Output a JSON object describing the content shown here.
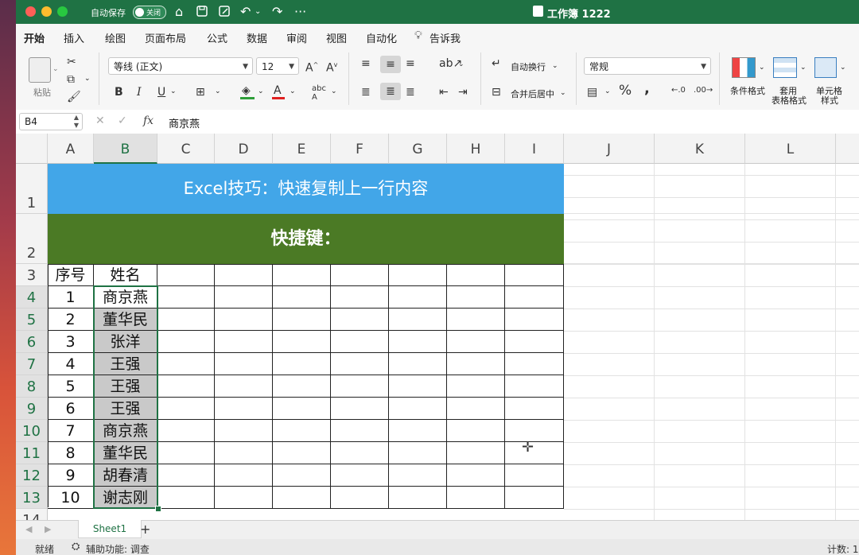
{
  "titlebar": {
    "autosave_label": "自动保存",
    "autosave_state": "关闭",
    "title": "工作簿 1222",
    "icons": [
      "home-icon",
      "save-icon",
      "save-as-icon",
      "undo-icon",
      "redo-icon",
      "more-icon"
    ]
  },
  "menu": [
    "开始",
    "插入",
    "绘图",
    "页面布局",
    "公式",
    "数据",
    "审阅",
    "视图",
    "自动化",
    "告诉我"
  ],
  "ribbon": {
    "paste_label": "粘贴",
    "font_name": "等线 (正文)",
    "font_size": "12",
    "wrap_text": "自动换行",
    "merge_center": "合并后居中",
    "number_format": "常规",
    "conditional_format": "条件格式",
    "table_format_line1": "套用",
    "table_format_line2": "表格格式",
    "cell_style_line1": "单元格",
    "cell_style_line2": "样式",
    "bold": "B",
    "italic": "I",
    "underline": "U",
    "percent": "%",
    "comma": ",",
    "fx": "fx"
  },
  "formula_bar": {
    "name_box": "B4",
    "formula": "商京燕"
  },
  "columns": [
    "A",
    "B",
    "C",
    "D",
    "E",
    "F",
    "G",
    "H",
    "I",
    "J",
    "K",
    "L"
  ],
  "rows": [
    "1",
    "2",
    "3",
    "4",
    "5",
    "6",
    "7",
    "8",
    "9",
    "10",
    "11",
    "12",
    "13",
    "14"
  ],
  "sheet": {
    "title_banner": "Excel技巧：快速复制上一行内容",
    "shortcut_banner": "快捷键：",
    "header_seq": "序号",
    "header_name": "姓名",
    "data": [
      {
        "seq": "1",
        "name": "商京燕"
      },
      {
        "seq": "2",
        "name": "董华民"
      },
      {
        "seq": "3",
        "name": "张洋"
      },
      {
        "seq": "4",
        "name": "王强"
      },
      {
        "seq": "5",
        "name": "王强"
      },
      {
        "seq": "6",
        "name": "王强"
      },
      {
        "seq": "7",
        "name": "商京燕"
      },
      {
        "seq": "8",
        "name": "董华民"
      },
      {
        "seq": "9",
        "name": "胡春清"
      },
      {
        "seq": "10",
        "name": "谢志刚"
      }
    ]
  },
  "sheet_tabs": {
    "active": "Sheet1",
    "add": "+"
  },
  "status": {
    "ready": "就绪",
    "accessibility": "辅助功能: 调查",
    "count": "计数: 1"
  },
  "colors": {
    "title_green": "#1f7244",
    "banner_blue": "#42a6e8",
    "banner_green": "#4b7a25",
    "cell_grey": "#c9c9c9"
  }
}
